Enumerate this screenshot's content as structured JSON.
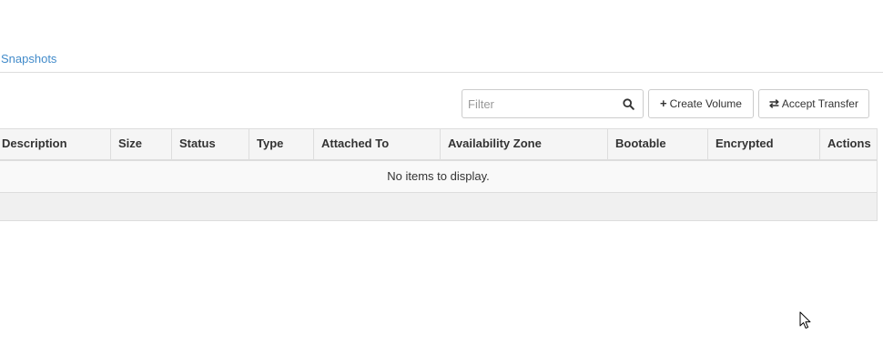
{
  "tabs": {
    "snapshots_label": "Snapshots"
  },
  "toolbar": {
    "filter_placeholder": "Filter",
    "filter_value": "",
    "create_volume_icon": "+",
    "create_volume_label": "Create Volume",
    "accept_transfer_icon": "⇄",
    "accept_transfer_label": "Accept Transfer"
  },
  "table": {
    "columns": [
      "Description",
      "Size",
      "Status",
      "Type",
      "Attached To",
      "Availability Zone",
      "Bootable",
      "Encrypted",
      "Actions"
    ],
    "empty_message": "No items to display."
  },
  "icons": {
    "search": "search-icon",
    "create": "plus-icon",
    "transfer": "transfer-icon",
    "cursor": "mouse-pointer-icon"
  },
  "colors": {
    "link": "#428bca",
    "header_bg": "#f5f5f5",
    "row_bg": "#f9f9f9",
    "footer_bg": "#f0f0f0",
    "border": "#dddddd"
  }
}
